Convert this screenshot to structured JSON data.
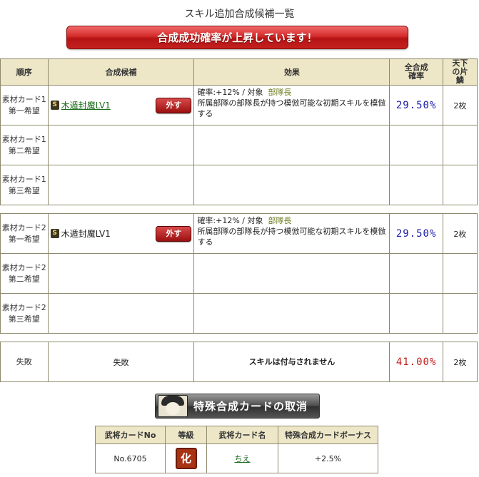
{
  "page": {
    "title": "スキル追加合成候補一覧",
    "banner": "合成成功確率が上昇しています！"
  },
  "table": {
    "headers": {
      "order": "順序",
      "candidate": "合成候補",
      "effect": "効果",
      "rate": "全合成確率",
      "pieces": "天下の片鱗"
    },
    "rows": [
      {
        "order_line1": "素材カード1",
        "order_line2": "第一希望",
        "skill_badge": "S",
        "skill_name": "木遁封魔LV1",
        "remove_label": "外す",
        "effect_line1": "確率:+12% / 対象",
        "effect_target": "部隊長",
        "effect_line2": "所属部隊の部隊長が持つ模倣可能な初期スキルを模倣する",
        "rate": "29.50%",
        "pieces": "2枚"
      },
      {
        "order_line1": "素材カード1",
        "order_line2": "第二希望"
      },
      {
        "order_line1": "素材カード1",
        "order_line2": "第三希望"
      },
      {
        "order_line1": "素材カード2",
        "order_line2": "第一希望",
        "skill_badge": "S",
        "skill_name": "木遁封魔LV1",
        "remove_label": "外す",
        "effect_line1": "確率:+12% / 対象",
        "effect_target": "部隊長",
        "effect_line2": "所属部隊の部隊長が持つ模倣可能な初期スキルを模倣する",
        "rate": "29.50%",
        "pieces": "2枚"
      },
      {
        "order_line1": "素材カード2",
        "order_line2": "第二希望"
      },
      {
        "order_line1": "素材カード2",
        "order_line2": "第三希望"
      }
    ],
    "fail_row": {
      "order": "失敗",
      "candidate": "失敗",
      "effect": "スキルは付与されません",
      "rate": "41.00%",
      "pieces": "2枚"
    }
  },
  "special": {
    "button_label": "特殊合成カードの取消",
    "headers": {
      "card_no": "武将カードNo",
      "grade": "等級",
      "card_name": "武将カード名",
      "bonus": "特殊合成カードボーナス"
    },
    "row": {
      "card_no": "No.6705",
      "grade": "化",
      "card_name": "ちえ",
      "bonus": "+2.5%"
    }
  },
  "colors": {
    "banner_red": "#d42a2a",
    "rate_blue": "#1a1aaa",
    "fail_red": "#c41a1a",
    "header_bg": "#ede7c8",
    "link_green": "#1a6a1a"
  }
}
